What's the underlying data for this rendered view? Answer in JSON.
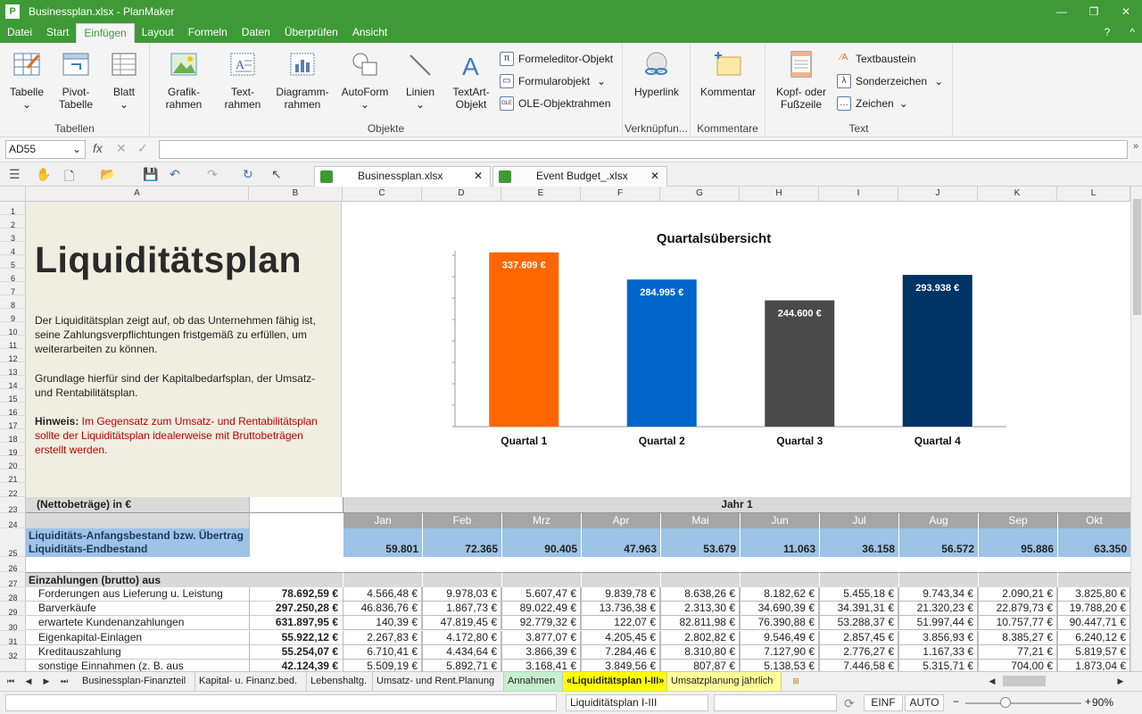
{
  "window": {
    "title": "Businessplan.xlsx - PlanMaker",
    "app_icon": "P",
    "minimize": "—",
    "restore": "❐",
    "close": "✕"
  },
  "menu": {
    "tabs": [
      "Datei",
      "Start",
      "Einfügen",
      "Layout",
      "Formeln",
      "Daten",
      "Überprüfen",
      "Ansicht"
    ],
    "active": "Einfügen",
    "help": "?",
    "collapse": "^"
  },
  "ribbon": {
    "tables": {
      "label": "Tabellen",
      "tabelle": "Tabelle",
      "pivot": "Pivot-\nTabelle",
      "blatt": "Blatt"
    },
    "objects": {
      "label": "Objekte",
      "grafik": "Grafik-\nrahmen",
      "text": "Text-\nrahmen",
      "diagramm": "Diagramm-\nrahmen",
      "autoform": "AutoForm",
      "linien": "Linien",
      "textart": "TextArt-\nObjekt",
      "formeleditor": "Formeleditor-Objekt",
      "formularobjekt": "Formularobjekt",
      "ole": "OLE-Objektrahmen"
    },
    "links": {
      "label": "Verknüpfun...",
      "hyperlink": "Hyperlink"
    },
    "comments": {
      "label": "Kommentare",
      "kommentar": "Kommentar"
    },
    "text": {
      "label": "Text",
      "kopf": "Kopf- oder\nFußzeile",
      "textbaustein": "Textbaustein",
      "sonderzeichen": "Sonderzeichen",
      "zeichen": "Zeichen"
    }
  },
  "formula": {
    "cell_ref": "AD55",
    "fx": "fx",
    "cancel": "✕",
    "confirm": "✓",
    "value": ""
  },
  "doc_tabs": [
    {
      "name": "Businessplan.xlsx"
    },
    {
      "name": "Event Budget_.xlsx"
    }
  ],
  "columns": [
    "A",
    "B",
    "C",
    "D",
    "E",
    "F",
    "G",
    "H",
    "I",
    "J",
    "K",
    "L"
  ],
  "rows": [
    "1",
    "2",
    "3",
    "4",
    "5",
    "6",
    "7",
    "8",
    "9",
    "10",
    "11",
    "12",
    "13",
    "14",
    "15",
    "16",
    "17",
    "18",
    "19",
    "20",
    "21",
    "22",
    "23",
    "24",
    "25",
    "26",
    "27",
    "28",
    "29",
    "30",
    "31",
    "32"
  ],
  "intro": {
    "title": "Liquiditätsplan",
    "para1": "Der Liquiditätsplan zeigt auf, ob das Unternehmen fähig ist, seine Zahlungsverpflichtungen fristgemäß zu erfüllen, um weiterarbeiten zu können.",
    "para2": "Grundlage hierfür sind der Kapitalbedarfsplan, der Umsatz- und Rentabilitätsplan.",
    "hinweis_label": "Hinweis:",
    "hinweis_text": " Im Gegensatz zum Umsatz- und Rentabilitätsplan sollte der Liquiditätsplan idealerweise mit Bruttobeträgen erstellt werden."
  },
  "chart_data": {
    "type": "bar",
    "title": "Quartalsübersicht",
    "categories": [
      "Quartal 1",
      "Quartal 2",
      "Quartal 3",
      "Quartal 4"
    ],
    "values": [
      337609,
      284995,
      244600,
      293938
    ],
    "labels": [
      "337.609 €",
      "284.995 €",
      "244.600 €",
      "293.938 €"
    ],
    "colors": [
      "#ff6600",
      "#0066cc",
      "#4a4a4a",
      "#003366"
    ],
    "ylim": [
      0,
      370000
    ]
  },
  "table": {
    "header_label": "(Nettobeträge) in €",
    "year": "Jahr 1",
    "months": [
      "Jan",
      "Feb",
      "Mrz",
      "Apr",
      "Mai",
      "Jun",
      "Jul",
      "Aug",
      "Sep",
      "Okt"
    ],
    "opening_label_1": "Liquiditäts-Anfangsbestand bzw. Übertrag",
    "opening_label_2": "Liquiditäts-Endbestand",
    "opening_values": [
      "59.801",
      "72.365",
      "90.405",
      "47.963",
      "53.679",
      "11.063",
      "36.158",
      "56.572",
      "95.886",
      "63.350"
    ],
    "section": "Einzahlungen (brutto) aus",
    "items": [
      {
        "label": "Forderungen aus Lieferung u. Leistung",
        "total": "78.692,59 €",
        "values": [
          "4.566,48 €",
          "9.978,03 €",
          "5.607,47 €",
          "9.839,78 €",
          "8.638,26 €",
          "8.182,62 €",
          "5.455,18 €",
          "9.743,34 €",
          "2.090,21 €",
          "3.825,80 €"
        ]
      },
      {
        "label": "Barverkäufe",
        "total": "297.250,28 €",
        "values": [
          "46.836,76 €",
          "1.867,73 €",
          "89.022,49 €",
          "13.736,38 €",
          "2.313,30 €",
          "34.690,39 €",
          "34.391,31 €",
          "21.320,23 €",
          "22.879,73 €",
          "19.788,20 €"
        ]
      },
      {
        "label": "erwartete Kundenanzahlungen",
        "total": "631.897,95 €",
        "values": [
          "140,39 €",
          "47.819,45 €",
          "92.779,32 €",
          "122,07 €",
          "82.811,98 €",
          "76.390,88 €",
          "53.288,37 €",
          "51.997,44 €",
          "10.757,77 €",
          "90.447,71 €"
        ]
      },
      {
        "label": "Eigenkapital-Einlagen",
        "total": "55.922,12 €",
        "values": [
          "2.267,83 €",
          "4.172,80 €",
          "3.877,07 €",
          "4.205,45 €",
          "2.802,82 €",
          "9.546,49 €",
          "2.857,45 €",
          "3.856,93 €",
          "8.385,27 €",
          "6.240,12 €"
        ]
      },
      {
        "label": "Kreditauszahlung",
        "total": "55.254,07 €",
        "values": [
          "6.710,41 €",
          "4.434,64 €",
          "3.866,39 €",
          "7.284,46 €",
          "8.310,80 €",
          "7.127,90 €",
          "2.776,27 €",
          "1.167,33 €",
          "77,21 €",
          "5.819,57 €"
        ]
      },
      {
        "label": "sonstige Einnahmen (z. B. aus",
        "total": "42.124,39 €",
        "values": [
          "5.509,19 €",
          "5.892,71 €",
          "3.168,41 €",
          "3.849,56 €",
          "807,87 €",
          "5.138,53 €",
          "7.446,58 €",
          "5.315,71 €",
          "704,00 €",
          "1.873,04 €"
        ]
      }
    ]
  },
  "sheet_tabs": [
    {
      "name": "Businessplan-Finanzteil",
      "color": ""
    },
    {
      "name": "Kapital- u. Finanz.bed.",
      "color": ""
    },
    {
      "name": "Lebenshaltg.",
      "color": ""
    },
    {
      "name": "Umsatz- und Rent.Planung",
      "color": ""
    },
    {
      "name": "Annahmen",
      "color": "#c6efce"
    },
    {
      "name": "«Liquiditätsplan I-III»",
      "color": "#ffff00"
    },
    {
      "name": "Umsatzplanung jährlich",
      "color": "#ffff99"
    }
  ],
  "status": {
    "sheet": "Liquiditätsplan I-III",
    "mode": "EINF",
    "calc": "AUTO",
    "zoom": "90%",
    "zoom_level": 0.9
  }
}
